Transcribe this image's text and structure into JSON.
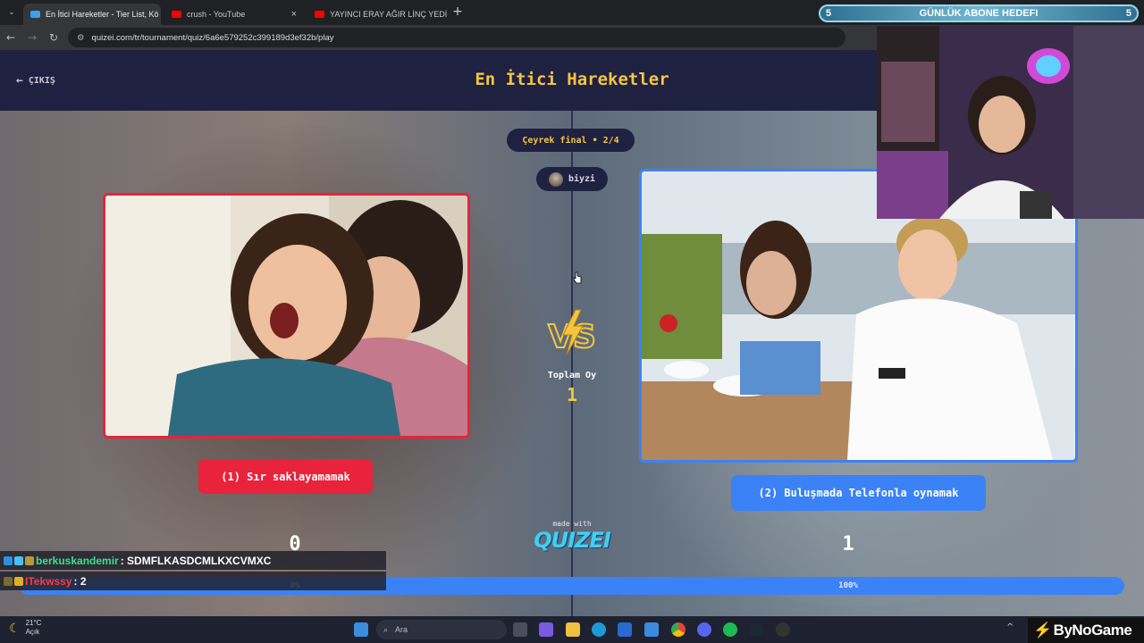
{
  "browser": {
    "tabs": [
      {
        "label": "En İtici Hareketler - Tier List, Kö",
        "active": true,
        "favicon_color": "#3aa0f0"
      },
      {
        "label": "crush - YouTube",
        "active": false,
        "favicon_color": "#ff0000"
      },
      {
        "label": "YAYINCI ERAY AĞIR LİNÇ YEDİ",
        "active": false,
        "favicon_color": "#ff0000"
      }
    ],
    "close_glyph": "×",
    "new_tab_glyph": "+",
    "url": "quizei.com/tr/tournament/quiz/6a6e579252c399189d3ef32b/play"
  },
  "header": {
    "exit_label": "ÇIKIŞ",
    "title": "En İtici Hareketler"
  },
  "round": {
    "label": "Çeyrek final • 2/4",
    "username": "biyzi"
  },
  "options": {
    "left_label": "(1) Sır saklayamamak",
    "right_label": "(2) Buluşmada Telefonla oynamak",
    "left_votes": "0",
    "right_votes": "1",
    "left_percent_label": "0%",
    "right_percent_label": "100%",
    "left_percent": 0,
    "right_percent": 100
  },
  "total_votes": {
    "label": "Toplam Oy",
    "value": "1"
  },
  "vs_text": "VS",
  "footer": {
    "made_with": "made with",
    "logo": "QUIZEI"
  },
  "chat": [
    {
      "user": "berkuskandemir",
      "user_color": "#3ce08c",
      "message": ": SDMFLKASDCMLKXCVMXC"
    },
    {
      "user": "ITekwssy",
      "user_color": "#ff3b3b",
      "message": ": 2"
    }
  ],
  "stream_goal": {
    "left_value": "5",
    "label": "GÜNLÜK ABONE HEDEFI",
    "right_value": "5"
  },
  "taskbar": {
    "temperature": "21°C",
    "weather": "Açık",
    "search_placeholder": "Ara",
    "brand": "ByNoGame"
  },
  "colors": {
    "accent_yellow": "#f4c542",
    "red_option": "#e8233b",
    "blue_option": "#3b82f6",
    "header_bg": "#1f2140"
  }
}
